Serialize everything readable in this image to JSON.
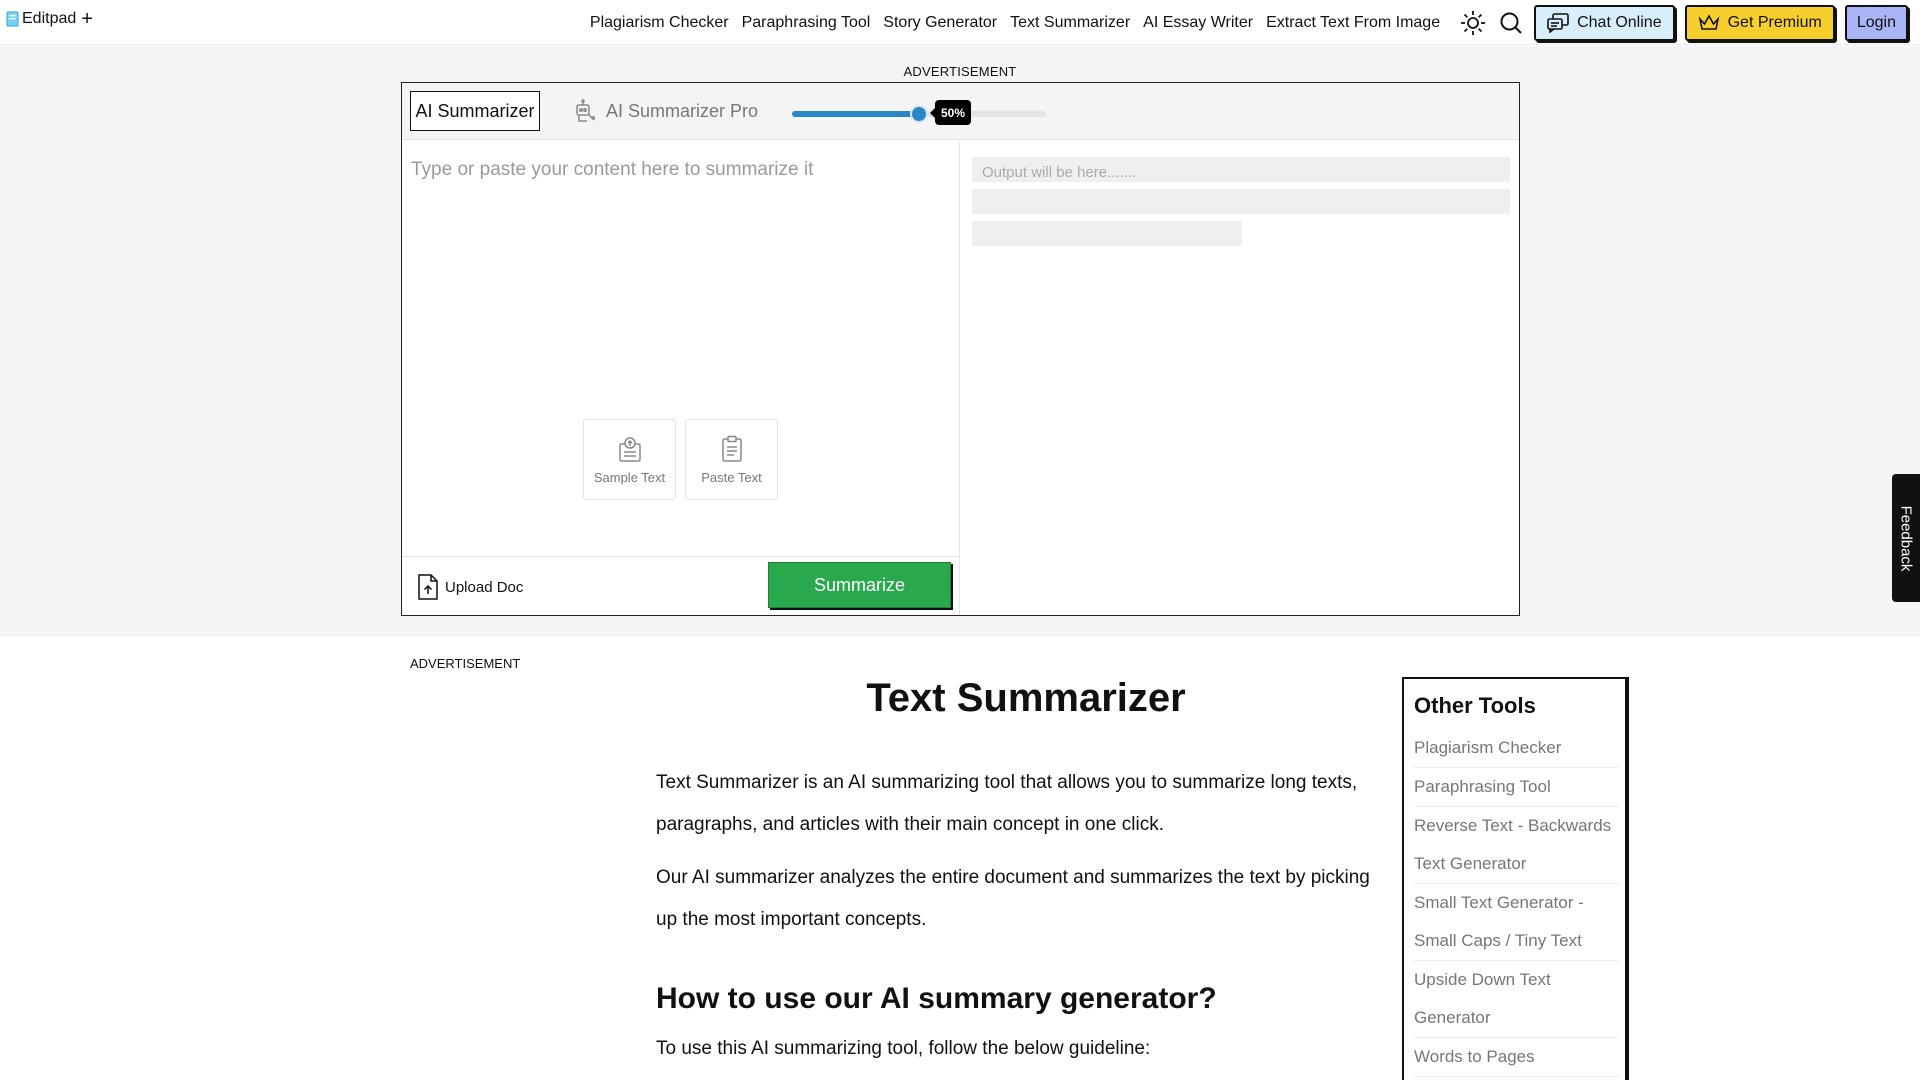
{
  "header": {
    "logo_text": "Editpad",
    "logo_plus": "+",
    "nav_links": [
      "Plagiarism Checker",
      "Paraphrasing Tool",
      "Story Generator",
      "Text Summarizer",
      "AI Essay Writer",
      "Extract Text From Image"
    ],
    "chat_label": "Chat Online",
    "premium_label": "Get Premium",
    "login_label": "Login"
  },
  "ad_label": "ADVERTISEMENT",
  "tool": {
    "tab_ai": "AI Summarizer",
    "tab_pro": "AI Summarizer Pro",
    "slider_percent": 50,
    "slider_label": "50%",
    "input_placeholder": "Type or paste your content here to summarize it",
    "sample_label": "Sample Text",
    "paste_label": "Paste Text",
    "upload_label": "Upload Doc",
    "summarize_label": "Summarize",
    "output_placeholder": "Output will be here......."
  },
  "feedback_label": "Feedback",
  "content": {
    "title": "Text Summarizer",
    "para1": "Text Summarizer is an AI summarizing tool that allows you to summarize long texts, paragraphs, and articles with their main concept in one click.",
    "para2": "Our AI summarizer analyzes the entire document and summarizes the text by picking up the most important concepts.",
    "h2": "How to use our AI summary generator?",
    "guide": "To use this AI summarizing tool, follow the below guideline:"
  },
  "other_tools": {
    "title": "Other Tools",
    "items": [
      "Plagiarism Checker",
      "Paraphrasing Tool",
      "Reverse Text - Backwards Text Generator",
      "Small Text Generator - Small Caps / Tiny Text",
      "Upside Down Text Generator",
      "Words to Pages"
    ]
  },
  "colors": {
    "accent_blue": "#2b86c8",
    "summarize_green": "#2aa84e",
    "premium_yellow": "#f7cf2c",
    "login_purple": "#a9b5f5",
    "band_grey": "#f2f4f6"
  }
}
